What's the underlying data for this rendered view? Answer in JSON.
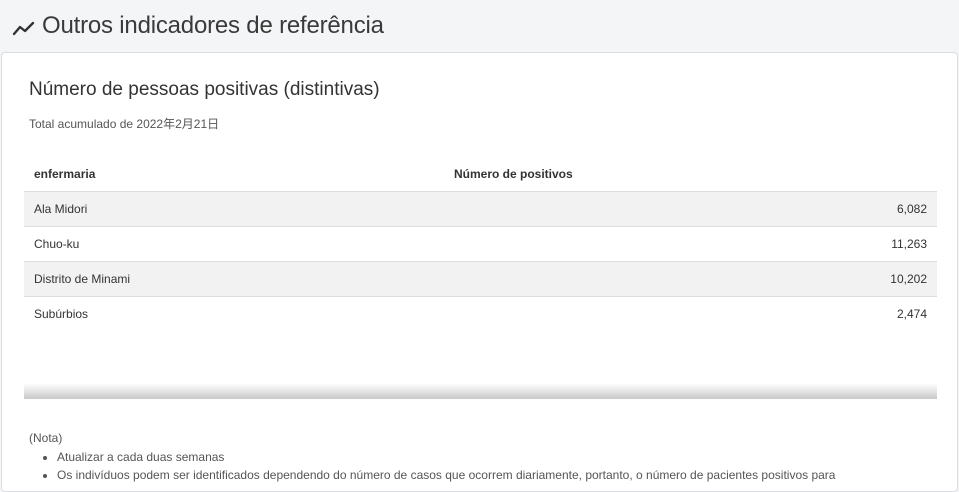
{
  "header": {
    "title": "Outros indicadores de referência",
    "icon": "trending-line-icon"
  },
  "card": {
    "title": "Número de pessoas positivas (distintivas)",
    "subtitle": "Total acumulado de 2022年2月21日"
  },
  "table": {
    "columns": [
      "enfermaria",
      "Número de positivos"
    ],
    "rows": [
      {
        "ward": "Ala Midori",
        "count": "6,082"
      },
      {
        "ward": "Chuo-ku",
        "count": "11,263"
      },
      {
        "ward": "Distrito de Minami",
        "count": "10,202"
      },
      {
        "ward": "Subúrbios",
        "count": "2,474"
      }
    ]
  },
  "notes": {
    "label": "(Nota)",
    "items": [
      "Atualizar a cada duas semanas",
      "Os indivíduos podem ser identificados dependendo do número de casos que ocorrem diariamente, portanto, o número de pacientes positivos para"
    ]
  }
}
